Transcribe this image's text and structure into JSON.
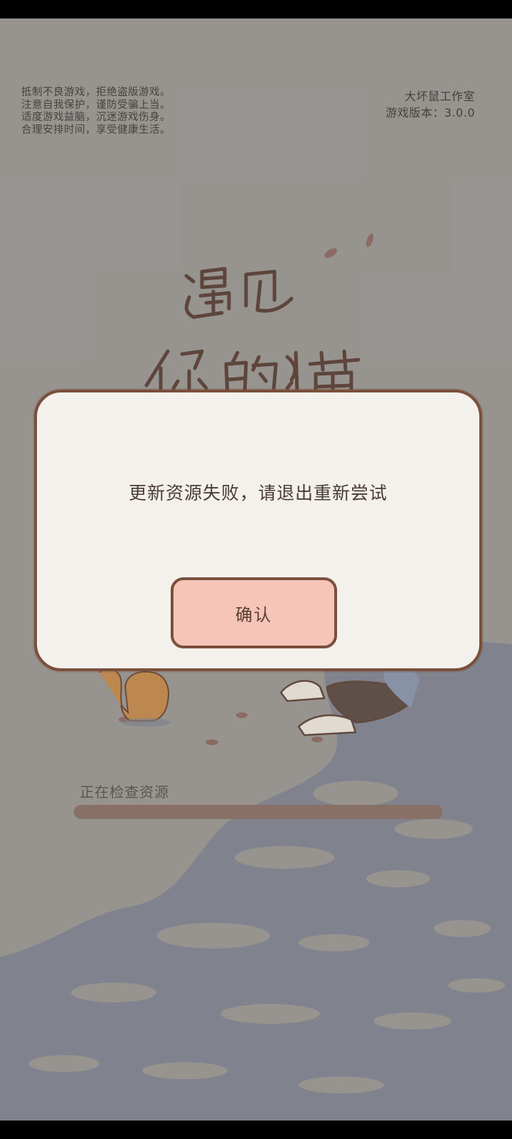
{
  "app": {
    "notice_lines": [
      "抵制不良游戏，拒绝盗版游戏。",
      "注意自我保护，谨防受骗上当。",
      "适度游戏益脑，沉迷游戏伤身。",
      "合理安排时间，享受健康生活。"
    ],
    "studio": "大坏鼠工作室",
    "version": "游戏版本：3.0.0",
    "logo_text": "遇见你的猫"
  },
  "loading": {
    "label": "正在检查资源",
    "progress": 1.0
  },
  "dialog": {
    "message": "更新资源失败，请退出重新尝试",
    "confirm_label": "确认"
  },
  "colors": {
    "background": "#9b9995",
    "dialog_bg": "#f4f1ec",
    "dialog_border": "#7a4f3c",
    "button_bg": "#f6c5b8",
    "progress": "#8a7066"
  }
}
